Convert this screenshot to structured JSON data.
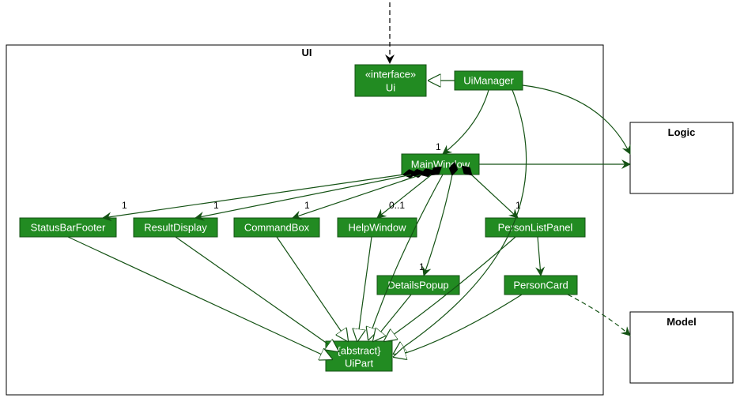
{
  "packages": {
    "ui": {
      "label": "UI"
    },
    "logic": {
      "label": "Logic"
    },
    "model": {
      "label": "Model"
    }
  },
  "nodes": {
    "ui_if": {
      "stereo": "«interface»",
      "name": "Ui"
    },
    "ui_manager": {
      "name": "UiManager"
    },
    "main_window": {
      "name": "MainWindow"
    },
    "status_bar": {
      "name": "StatusBarFooter"
    },
    "result_display": {
      "name": "ResultDisplay"
    },
    "command_box": {
      "name": "CommandBox"
    },
    "help_window": {
      "name": "HelpWindow"
    },
    "person_list": {
      "name": "PersonListPanel"
    },
    "details_popup": {
      "name": "DetailsPopup"
    },
    "person_card": {
      "name": "PersonCard"
    },
    "ui_part": {
      "stereo": "{abstract}",
      "name": "UiPart"
    }
  },
  "multiplicities": {
    "mw_from_mgr": "1",
    "sbf": "1",
    "rd": "1",
    "cb": "1",
    "hw": "0..1",
    "plp": "1",
    "dp": "1"
  },
  "chart_data": {
    "type": "uml-class-diagram",
    "packages": [
      "UI",
      "Logic",
      "Model"
    ],
    "classes": [
      {
        "name": "Ui",
        "stereotype": "interface",
        "package": "UI"
      },
      {
        "name": "UiManager",
        "package": "UI"
      },
      {
        "name": "MainWindow",
        "package": "UI"
      },
      {
        "name": "StatusBarFooter",
        "package": "UI"
      },
      {
        "name": "ResultDisplay",
        "package": "UI"
      },
      {
        "name": "CommandBox",
        "package": "UI"
      },
      {
        "name": "HelpWindow",
        "package": "UI"
      },
      {
        "name": "PersonListPanel",
        "package": "UI"
      },
      {
        "name": "DetailsPopup",
        "package": "UI"
      },
      {
        "name": "PersonCard",
        "package": "UI"
      },
      {
        "name": "UiPart",
        "stereotype": "abstract",
        "package": "UI"
      }
    ],
    "relations": [
      {
        "from": "external",
        "to": "Ui",
        "kind": "dependency"
      },
      {
        "from": "UiManager",
        "to": "Ui",
        "kind": "realization"
      },
      {
        "from": "UiManager",
        "to": "MainWindow",
        "kind": "association",
        "multiplicity": "1"
      },
      {
        "from": "UiManager",
        "to": "Logic",
        "kind": "association"
      },
      {
        "from": "MainWindow",
        "to": "Logic",
        "kind": "association"
      },
      {
        "from": "MainWindow",
        "to": "StatusBarFooter",
        "kind": "composition",
        "multiplicity": "1"
      },
      {
        "from": "MainWindow",
        "to": "ResultDisplay",
        "kind": "composition",
        "multiplicity": "1"
      },
      {
        "from": "MainWindow",
        "to": "CommandBox",
        "kind": "composition",
        "multiplicity": "1"
      },
      {
        "from": "MainWindow",
        "to": "HelpWindow",
        "kind": "composition",
        "multiplicity": "0..1"
      },
      {
        "from": "MainWindow",
        "to": "PersonListPanel",
        "kind": "composition",
        "multiplicity": "1"
      },
      {
        "from": "MainWindow",
        "to": "DetailsPopup",
        "kind": "composition",
        "multiplicity": "1"
      },
      {
        "from": "PersonListPanel",
        "to": "PersonCard",
        "kind": "association"
      },
      {
        "from": "PersonCard",
        "to": "Model",
        "kind": "dependency"
      },
      {
        "from": "MainWindow",
        "to": "UiPart",
        "kind": "generalization"
      },
      {
        "from": "UiManager",
        "to": "UiPart",
        "kind": "generalization"
      },
      {
        "from": "StatusBarFooter",
        "to": "UiPart",
        "kind": "generalization"
      },
      {
        "from": "ResultDisplay",
        "to": "UiPart",
        "kind": "generalization"
      },
      {
        "from": "CommandBox",
        "to": "UiPart",
        "kind": "generalization"
      },
      {
        "from": "HelpWindow",
        "to": "UiPart",
        "kind": "generalization"
      },
      {
        "from": "PersonListPanel",
        "to": "UiPart",
        "kind": "generalization"
      },
      {
        "from": "DetailsPopup",
        "to": "UiPart",
        "kind": "generalization"
      },
      {
        "from": "PersonCard",
        "to": "UiPart",
        "kind": "generalization"
      }
    ]
  }
}
